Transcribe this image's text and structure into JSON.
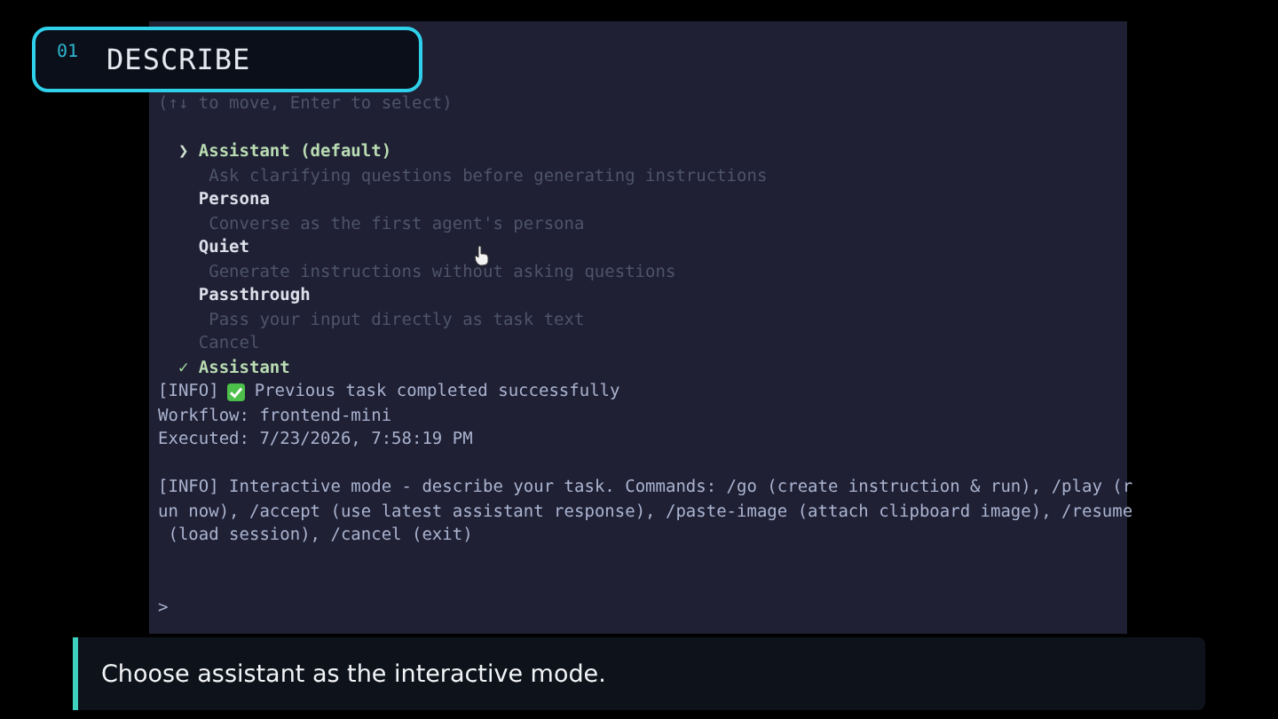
{
  "badge": {
    "number": "01",
    "title": "DESCRIBE"
  },
  "terminal": {
    "hint": "(↑↓ to move, Enter to select)",
    "pointer": "❯",
    "options": [
      {
        "label": "Assistant (default)",
        "description": "Ask clarifying questions before generating instructions",
        "selected": true
      },
      {
        "label": "Persona",
        "description": "Converse as the first agent's persona",
        "selected": false
      },
      {
        "label": "Quiet",
        "description": "Generate instructions without asking questions",
        "selected": false
      },
      {
        "label": "Passthrough",
        "description": "Pass your input directly as task text",
        "selected": false
      }
    ],
    "cancel": "Cancel",
    "result": {
      "mark": "✓",
      "label": "Assistant"
    },
    "lines": [
      {
        "kind": "success",
        "tag": "[INFO]",
        "text": "Previous task completed successfully"
      },
      {
        "kind": "plain",
        "text": "Workflow: frontend-mini"
      },
      {
        "kind": "plain",
        "text": "Executed: 7/23/2026, 7:58:19 PM"
      },
      {
        "kind": "blank"
      },
      {
        "kind": "wrap",
        "text": "[INFO] Interactive mode - describe your task. Commands: /go (create instruction & run), /play (run now), /accept (use latest assistant response), /paste-image (attach clipboard image), /resume (load session), /cancel (exit)"
      },
      {
        "kind": "blank"
      },
      {
        "kind": "blank"
      }
    ],
    "prompt": ">"
  },
  "caption": "Choose assistant as the interactive mode."
}
